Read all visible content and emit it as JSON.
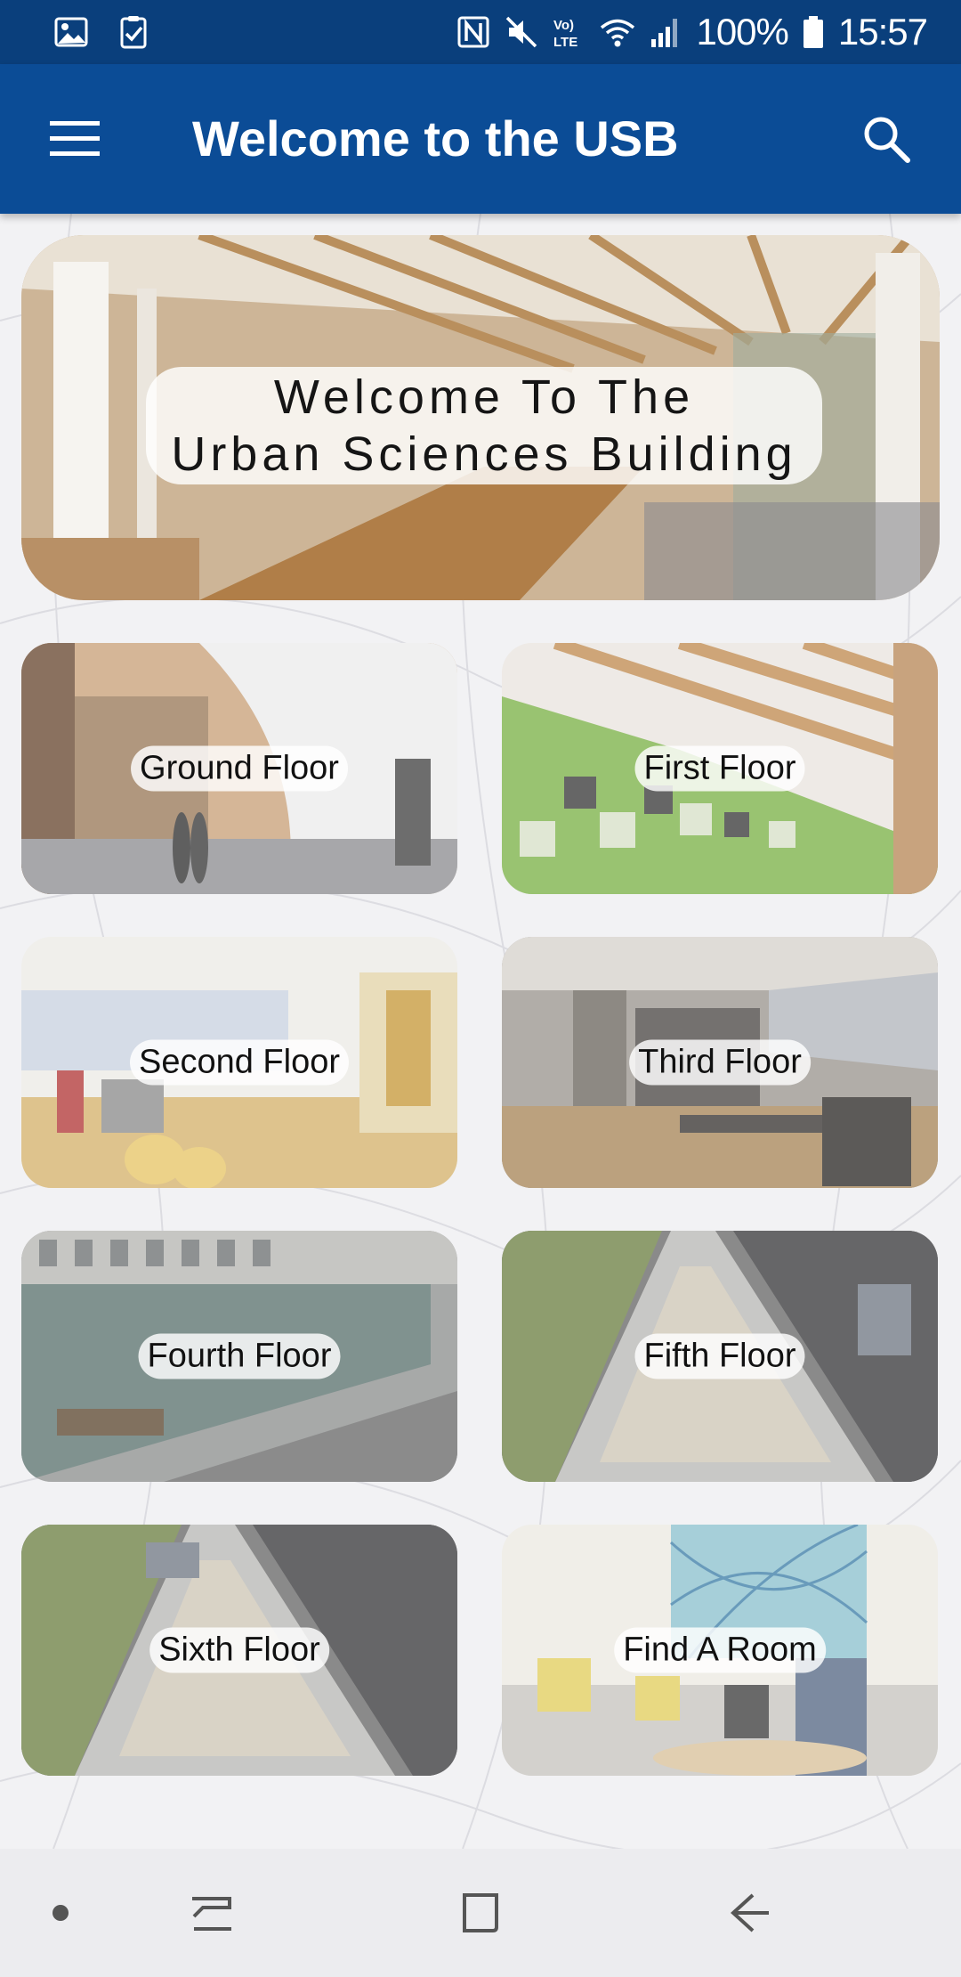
{
  "status_bar": {
    "battery": "100%",
    "time": "15:57",
    "icons": [
      "image-icon",
      "clipboard-check-icon",
      "nfc-icon",
      "mute-icon",
      "volte-icon",
      "wifi-icon",
      "signal-icon",
      "battery-icon"
    ],
    "volte_top": "Vo)",
    "volte_bottom": "LTE"
  },
  "app_bar": {
    "title": "Welcome to the USB",
    "menu_icon": "menu-icon",
    "search_icon": "search-icon",
    "color": "#0b4c96"
  },
  "hero": {
    "line1": "Welcome To The",
    "line2": "Urban Sciences Building"
  },
  "tiles": [
    {
      "label": "Ground Floor"
    },
    {
      "label": "First Floor"
    },
    {
      "label": "Second Floor"
    },
    {
      "label": "Third Floor"
    },
    {
      "label": "Fourth Floor"
    },
    {
      "label": "Fifth Floor"
    },
    {
      "label": "Sixth Floor"
    },
    {
      "label": "Find A Room"
    }
  ],
  "nav_bar": {
    "icons": [
      "dot-icon",
      "recent-apps-icon",
      "home-icon",
      "back-icon"
    ]
  }
}
